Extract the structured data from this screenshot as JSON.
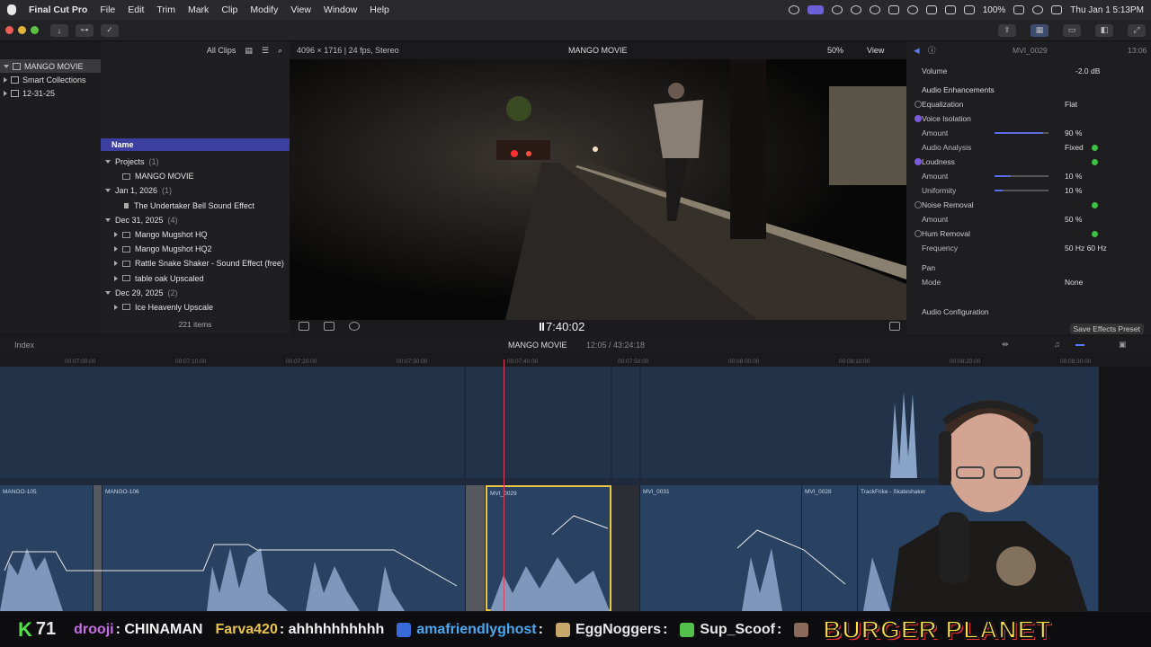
{
  "menubar": {
    "app": "Final Cut Pro",
    "items": [
      "File",
      "Edit",
      "Trim",
      "Mark",
      "Clip",
      "Modify",
      "View",
      "Window",
      "Help"
    ],
    "battery": "100%",
    "clock": "Thu Jan 1  5:13PM"
  },
  "libraries": {
    "items": [
      {
        "label": "MANGO MOVIE",
        "selected": true
      },
      {
        "label": "Smart Collections"
      },
      {
        "label": "12-31-25"
      }
    ]
  },
  "browser": {
    "filter": "All Clips",
    "column_header": "Name",
    "rows": [
      {
        "label": "Projects",
        "count": "(1)",
        "kind": "group"
      },
      {
        "label": "MANGO MOVIE",
        "kind": "project"
      },
      {
        "label": "Jan 1, 2026",
        "count": "(1)",
        "kind": "group"
      },
      {
        "label": "The Undertaker Bell   Sound Effect",
        "kind": "audio"
      },
      {
        "label": "Dec 31, 2025",
        "count": "(4)",
        "kind": "group"
      },
      {
        "label": "Mango Mugshot HQ",
        "kind": "clip"
      },
      {
        "label": "Mango Mugshot HQ2",
        "kind": "clip"
      },
      {
        "label": "Rattle Snake Shaker - Sound Effect (free)",
        "kind": "clip"
      },
      {
        "label": "table oak Upscaled",
        "kind": "clip"
      },
      {
        "label": "Dec 29, 2025",
        "count": "(2)",
        "kind": "group"
      },
      {
        "label": "Ice Heavenly Upscale",
        "kind": "clip"
      }
    ],
    "item_count": "221 items"
  },
  "viewer": {
    "format": "4096 × 1716 | 24 fps, Stereo",
    "title": "MANGO MOVIE",
    "zoom": "50%",
    "view_label": "View",
    "timecode": "7:40:02"
  },
  "inspector": {
    "clip_name": "MVI_0029",
    "duration": "13:06",
    "volume_label": "Volume",
    "volume_value": "-2.0  dB",
    "section": "Audio Enhancements",
    "rows": [
      {
        "label": "Equalization",
        "value": "Flat",
        "check": "off",
        "indent": false
      },
      {
        "label": "Voice Isolation",
        "check": "on",
        "indent": false
      },
      {
        "label": "Amount",
        "value": "90  %",
        "slider": 0.9,
        "indent": true
      },
      {
        "label": "Audio Analysis",
        "value": "Fixed",
        "ok": true,
        "indent": true
      },
      {
        "label": "Loudness",
        "check": "on",
        "ok": true,
        "indent": false
      },
      {
        "label": "Amount",
        "value": "10  %",
        "slider": 0.3,
        "indent": true
      },
      {
        "label": "Uniformity",
        "value": "10  %",
        "slider": 0.15,
        "indent": true
      },
      {
        "label": "Noise Removal",
        "check": "off",
        "ok": true,
        "indent": false
      },
      {
        "label": "Amount",
        "value": "50  %",
        "indent": true
      },
      {
        "label": "Hum Removal",
        "check": "off",
        "ok": true,
        "indent": false
      },
      {
        "label": "Frequency",
        "value": "50 Hz     60 Hz",
        "indent": true
      },
      {
        "label": "Pan",
        "indent": false
      },
      {
        "label": "Mode",
        "value": "None",
        "indent": true
      }
    ],
    "audio_config": "Audio Configuration",
    "save_preset": "Save Effects Preset"
  },
  "timeline": {
    "index_label": "Index",
    "project": "MANGO MOVIE",
    "duration": "12:05 / 43:24:18",
    "ruler": [
      "00:07:00:00",
      "00:07:10:00",
      "00:07:20:00",
      "00:07:30:00",
      "00:07:40:00",
      "00:07:50:00",
      "00:08:00:00",
      "00:08:10:00",
      "00:08:20:00",
      "00:08:30:00"
    ],
    "clips": [
      {
        "name": "MANGO-105"
      },
      {
        "name": "MANGO-106"
      },
      {
        "name": "MVI_0029"
      },
      {
        "name": "MVI_0031"
      },
      {
        "name": "MVI_0028"
      },
      {
        "name": "TrackFrike - Skateshaker"
      }
    ]
  },
  "chat": {
    "badge": "K",
    "count": "71",
    "messages": [
      {
        "user": "drooji",
        "user_color": "#c86ce8",
        "text": ": CHINAMAN"
      },
      {
        "user": "Farva420",
        "user_color": "#e6c44a",
        "text": ": ahhhhhhhhhh"
      },
      {
        "user": "amafriendlyghost",
        "user_color": "#4aa8f0",
        "text": ":"
      },
      {
        "user": "EggNoggers",
        "user_color": "#e8e8e8",
        "text": ":"
      },
      {
        "user": "Sup_Scoof",
        "user_color": "#e8e8e8",
        "text": ":"
      }
    ],
    "brand": "BURGER PLANET"
  }
}
